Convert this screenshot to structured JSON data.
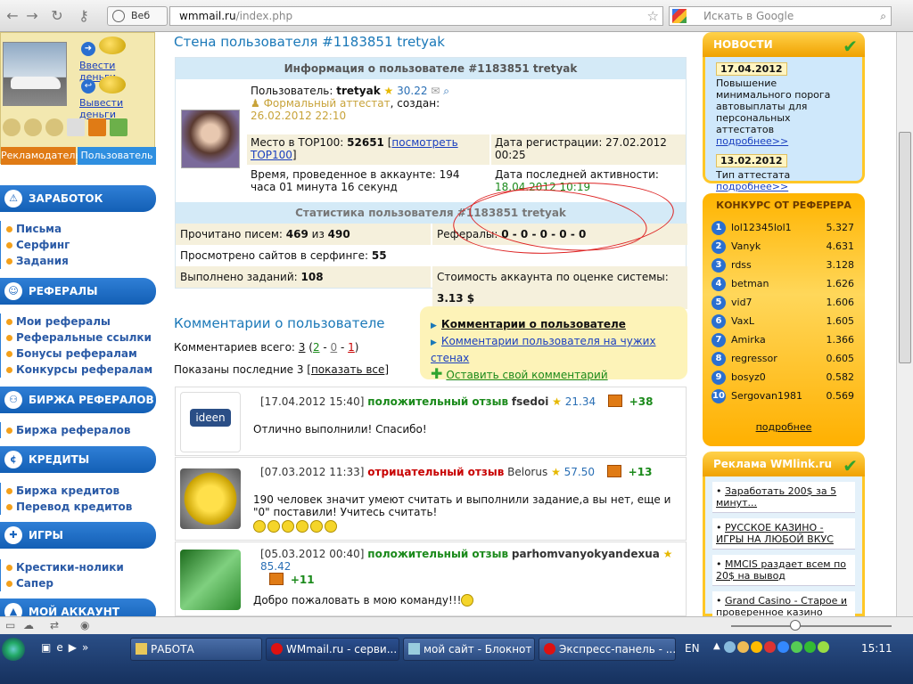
{
  "browser": {
    "web_tab_label": "Веб",
    "url_domain": "wmmail.ru",
    "url_path": "/index.php",
    "search_placeholder": "Искать в Google"
  },
  "left": {
    "deposit_link": "Ввести деньги",
    "withdraw_link": "Вывести деньги",
    "tab_advertiser": "Рекламодатель",
    "tab_user": "Пользователь",
    "sections": [
      {
        "title": "ЗАРАБОТОК",
        "items": [
          "Письма",
          "Серфинг",
          "Задания"
        ]
      },
      {
        "title": "РЕФЕРАЛЫ",
        "items": [
          "Мои рефералы",
          "Реферальные ссылки",
          "Бонусы рефералам",
          "Конкурсы рефералам"
        ]
      },
      {
        "title": "БИРЖА РЕФЕРАЛОВ",
        "items": [
          "Биржа рефералов"
        ]
      },
      {
        "title": "КРЕДИТЫ",
        "items": [
          "Биржа кредитов",
          "Перевод кредитов"
        ]
      },
      {
        "title": "ИГРЫ",
        "items": [
          "Крестики-нолики",
          "Сапер"
        ]
      },
      {
        "title": "МОЙ АККАУНТ",
        "items": []
      }
    ]
  },
  "center": {
    "page_title": "Стена пользователя #1183851 tretyak",
    "info_header": "Информация о пользователе #1183851 tretyak",
    "user_label": "Пользователь:",
    "username": "tretyak",
    "rating": "30.22",
    "attestat": "Формальный аттестат",
    "created_label": ", создан:",
    "created_date": "26.02.2012 22:10",
    "top100_label": "Место в TOP100:",
    "top100_value": "52651",
    "top100_link": "посмотреть TOP100",
    "reg_label": "Дата регистрации: 27.02.2012 00:25",
    "time_label": "Время, проведенное в аккаунте: 194 часа 01 минута 16 секунд",
    "last_activity_label": "Дата последней активности:",
    "last_activity_value": "18.04.2012 10:19",
    "stats_header": "Статистика пользователя #1183851 tretyak",
    "stats": {
      "letters_label": "Прочитано писем:",
      "letters_read": "469",
      "letters_of": "из",
      "letters_total": "490",
      "referrals_label": "Рефералы:",
      "referrals_value": "0 - 0 - 0 - 0 - 0",
      "surf_label": "Просмотрено сайтов в серфинге:",
      "surf_value": "55",
      "tasks_label": "Выполнено заданий:",
      "tasks_value": "108",
      "cost_label": "Стоимость аккаунта по оценке системы:",
      "cost_value": "3.13 $"
    },
    "comments_title": "Комментарии о пользователе",
    "comments_total_label": "Комментариев всего:",
    "comments_total": "3",
    "comments_pos": "2",
    "comments_neu": "0",
    "comments_neg": "1",
    "shown_label": "Показаны последние 3",
    "show_all": "показать все",
    "links": {
      "about": "Комментарии о пользователе",
      "others": "Комментарии пользователя на чужих стенах",
      "add": "Оставить свой комментарий"
    },
    "comments": [
      {
        "time": "[17.04.2012 15:40]",
        "type": "положительный отзыв",
        "author": "fsedoi",
        "rating": "21.34",
        "score": "+38",
        "text": "Отлично выполнили! Спасибо!",
        "avatar_text": "ideen"
      },
      {
        "time": "[07.03.2012 11:33]",
        "type": "отрицательный отзыв",
        "author": "Belorus",
        "rating": "57.50",
        "score": "+13",
        "text": "190 человек значит умеют считать и выполнили задание,а вы нет, еще и \"0\" поставили! Учитесь считать!",
        "avatar_text": ""
      },
      {
        "time": "[05.03.2012 00:40]",
        "type": "положительный отзыв",
        "author": "parhomvanyokyandexua",
        "rating": "85.42",
        "score": "+11",
        "text": "Добро пожаловать в мою команду!!!",
        "avatar_text": ""
      }
    ]
  },
  "right": {
    "news_title": "НОВОСТИ",
    "news": [
      {
        "date": "17.04.2012",
        "text": "Повышение минимального порога автовыплаты для персональных аттестатов",
        "more": "подробнее>>"
      },
      {
        "date": "13.02.2012",
        "text": "Тип аттестата",
        "more": "подробнее>>"
      }
    ],
    "contest_title": "КОНКУРС ОТ РЕФЕРЕРА",
    "contest": [
      {
        "n": "1",
        "name": "lol12345lol1",
        "score": "5.327"
      },
      {
        "n": "2",
        "name": "Vanyk",
        "score": "4.631"
      },
      {
        "n": "3",
        "name": "rdss",
        "score": "3.128"
      },
      {
        "n": "4",
        "name": "betman",
        "score": "1.626"
      },
      {
        "n": "5",
        "name": "vid7",
        "score": "1.606"
      },
      {
        "n": "6",
        "name": "VaxL",
        "score": "1.605"
      },
      {
        "n": "7",
        "name": "Amirka",
        "score": "1.366"
      },
      {
        "n": "8",
        "name": "regressor",
        "score": "0.605"
      },
      {
        "n": "9",
        "name": "bosyz0",
        "score": "0.582"
      },
      {
        "n": "10",
        "name": "Sergovan1981",
        "score": "0.569"
      }
    ],
    "contest_more": "подробнее",
    "ads_title": "Реклама WMlink.ru",
    "ads": [
      "Заработать 200$ за 5 минут...",
      "РУССКОЕ КАЗИНО - ИГРЫ НА ЛЮБОЙ ВКУС",
      "MMCIS раздает всем по 20$ на вывод",
      "Grand Casino - Старое и проверенное казино"
    ]
  },
  "taskbar": {
    "tasks": [
      "РАБОТА",
      "WMmail.ru - серви...",
      "мой сайт - Блокнот",
      "Экспресс-панель - ..."
    ],
    "lang": "EN",
    "clock": "15:11"
  },
  "colors": {
    "accent_blue": "#1a78b8",
    "menu_blue": "#135fb5",
    "gold": "#ffc727",
    "positive": "#1b8a1b",
    "negative": "#c80000"
  }
}
